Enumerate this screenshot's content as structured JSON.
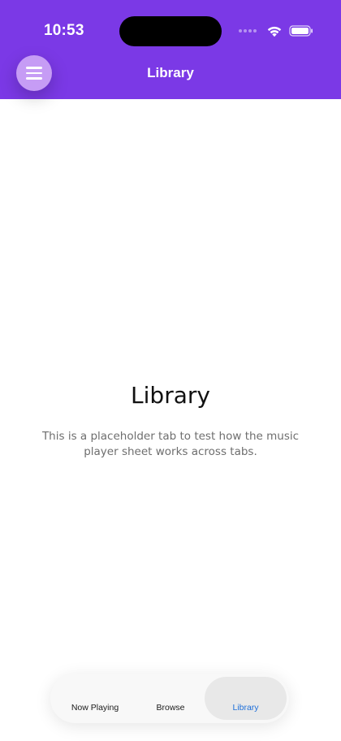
{
  "status_bar": {
    "time": "10:53",
    "icons": [
      "signal-dots-icon",
      "wifi-icon",
      "battery-icon"
    ]
  },
  "header": {
    "title": "Library",
    "menu_icon": "hamburger-menu-icon",
    "background_color": "#7b39e6",
    "menu_button_color": "#c69cf5"
  },
  "main": {
    "title": "Library",
    "body": "This is a placeholder tab to test how the music player sheet works across tabs."
  },
  "tab_bar": {
    "tabs": [
      {
        "label": "Now Playing",
        "selected": false
      },
      {
        "label": "Browse",
        "selected": false
      },
      {
        "label": "Library",
        "selected": true
      }
    ],
    "selected_color": "#1e6fd9"
  }
}
